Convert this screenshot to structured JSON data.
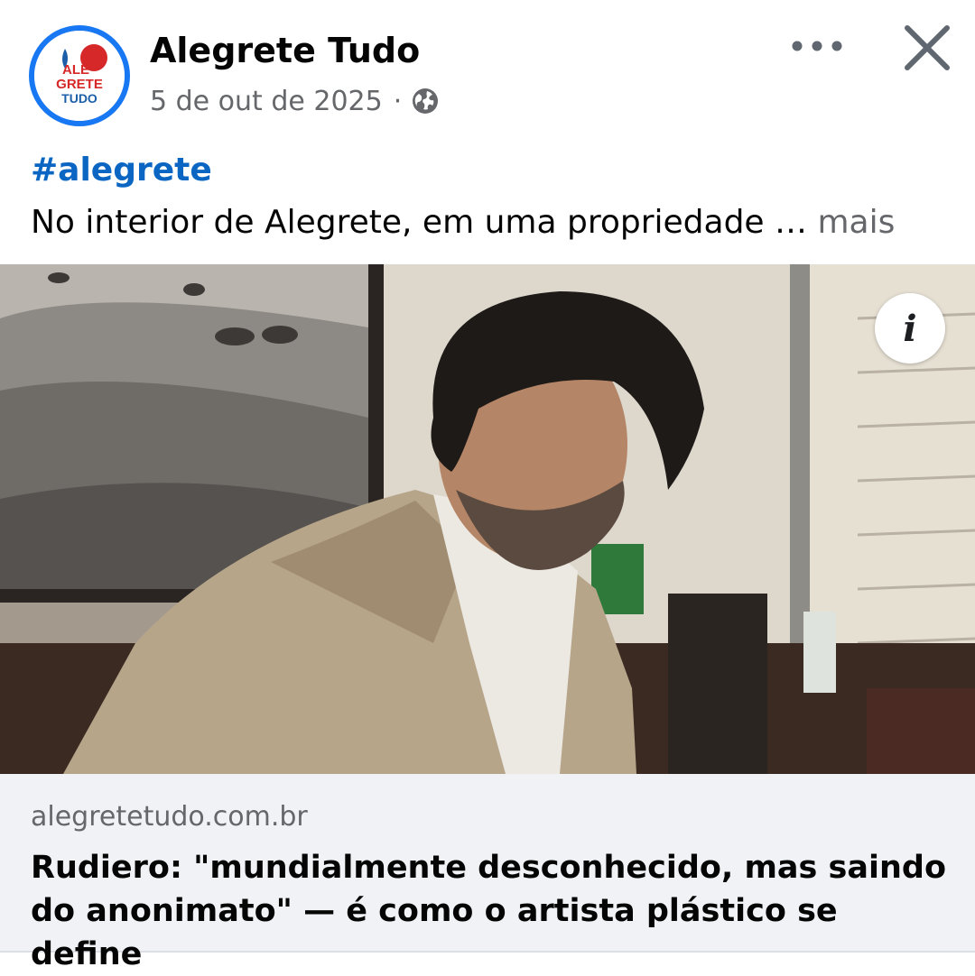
{
  "post": {
    "page_name": "Alegrete Tudo",
    "date": "5 de out de 2025",
    "separator": "·",
    "audience_icon": "globe-icon",
    "avatar": {
      "line1": "ALE",
      "line2": "GRETE",
      "line3": "TUDO",
      "ring_color": "#1877f2",
      "accent_color": "#d62828"
    },
    "hashtag": "#alegrete",
    "text": "No interior de Alegrete, em uma propriedade … ",
    "see_more_label": "mais",
    "more_icon": "more-options-icon",
    "close_icon": "close-icon"
  },
  "media": {
    "info_label": "i",
    "info_icon": "info-icon"
  },
  "link_preview": {
    "domain": "alegretetudo.com.br",
    "title": "Rudiero: \"mundialmente desconhecido, mas saindo do anonimato\" — é como o artista plástico se define"
  },
  "colors": {
    "hashtag": "#0a66c2",
    "secondary_text": "#65676b",
    "card_background": "#f0f2f5"
  }
}
